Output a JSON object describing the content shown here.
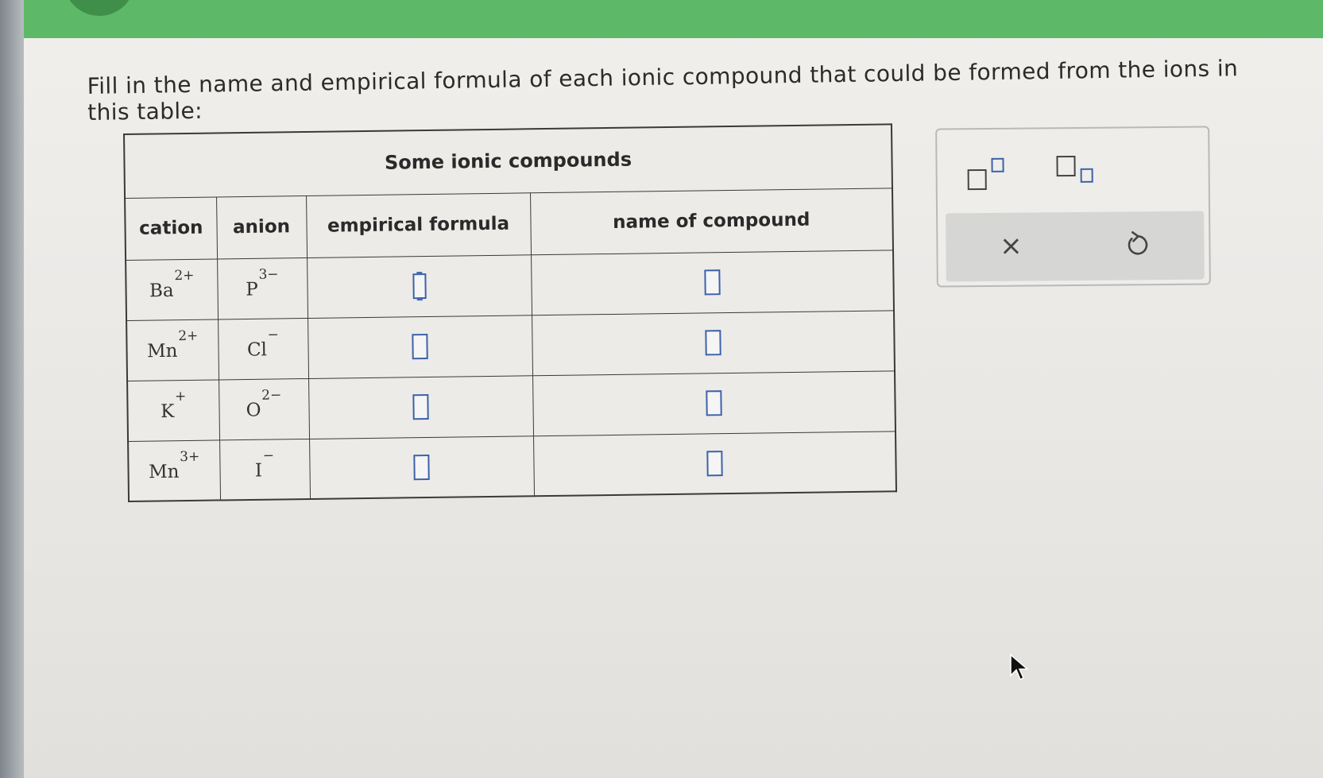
{
  "prompt": "Fill in the name and empirical formula of each ionic compound that could be formed from the ions in this table:",
  "table": {
    "caption": "Some ionic compounds",
    "headers": {
      "cation": "cation",
      "anion": "anion",
      "formula": "empirical formula",
      "name": "name of compound"
    },
    "rows": [
      {
        "cation": "Ba",
        "cation_charge": "2+",
        "anion": "P",
        "anion_charge": "3−"
      },
      {
        "cation": "Mn",
        "cation_charge": "2+",
        "anion": "Cl",
        "anion_charge": "−"
      },
      {
        "cation": "K",
        "cation_charge": "+",
        "anion": "O",
        "anion_charge": "2−"
      },
      {
        "cation": "Mn",
        "cation_charge": "3+",
        "anion": "I",
        "anion_charge": "−"
      }
    ]
  },
  "tools": {
    "superscript_icon": "superscript-box-icon",
    "subscript_icon": "subscript-box-icon",
    "clear_label": "×",
    "undo_icon": "undo-icon"
  },
  "colors": {
    "accent_green": "#5db867",
    "input_border": "#3d62a8"
  }
}
